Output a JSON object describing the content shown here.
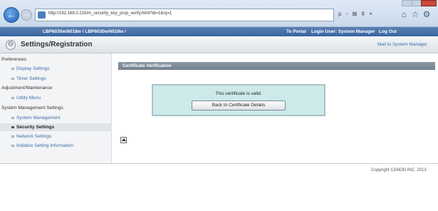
{
  "browser": {
    "url": "http://192.168.0.215/m_security_key_prop_verify.html?id=1&rq=1",
    "tools": "ρ - ⊠ ¢ ×"
  },
  "header": {
    "device": "LBP6030w/6018w / LBP6030w/6018w /",
    "to_portal": "To Portal",
    "login_user": "Login User: System Manager",
    "logout": "Log Out"
  },
  "titlebar": {
    "title": "Settings/Registration",
    "mail_link": "Mail to System Manager"
  },
  "sidebar": {
    "items": [
      {
        "label": "Preferences",
        "type": "category"
      },
      {
        "label": "Display Settings",
        "type": "sub"
      },
      {
        "label": "Timer Settings",
        "type": "sub"
      },
      {
        "label": "Adjustment/Maintenance",
        "type": "category"
      },
      {
        "label": "Utility Menu",
        "type": "sub"
      },
      {
        "label": "System Management Settings",
        "type": "category"
      },
      {
        "label": "System Management",
        "type": "sub"
      },
      {
        "label": "Security Settings",
        "type": "sub",
        "active": true
      },
      {
        "label": "Network Settings",
        "type": "sub"
      },
      {
        "label": "Initialize Setting Information",
        "type": "sub"
      }
    ]
  },
  "main": {
    "section_title": "Certificate Verification",
    "message": "This certificate is valid.",
    "back_button": "Back to Certificate Details"
  },
  "footer": {
    "copyright": "Copyright CANON INC. 2013"
  },
  "colors": {
    "header_bar": "#38659f",
    "section_bar": "#7f8c99",
    "message_box": "#cde9ea",
    "link": "#3b6ea8"
  }
}
